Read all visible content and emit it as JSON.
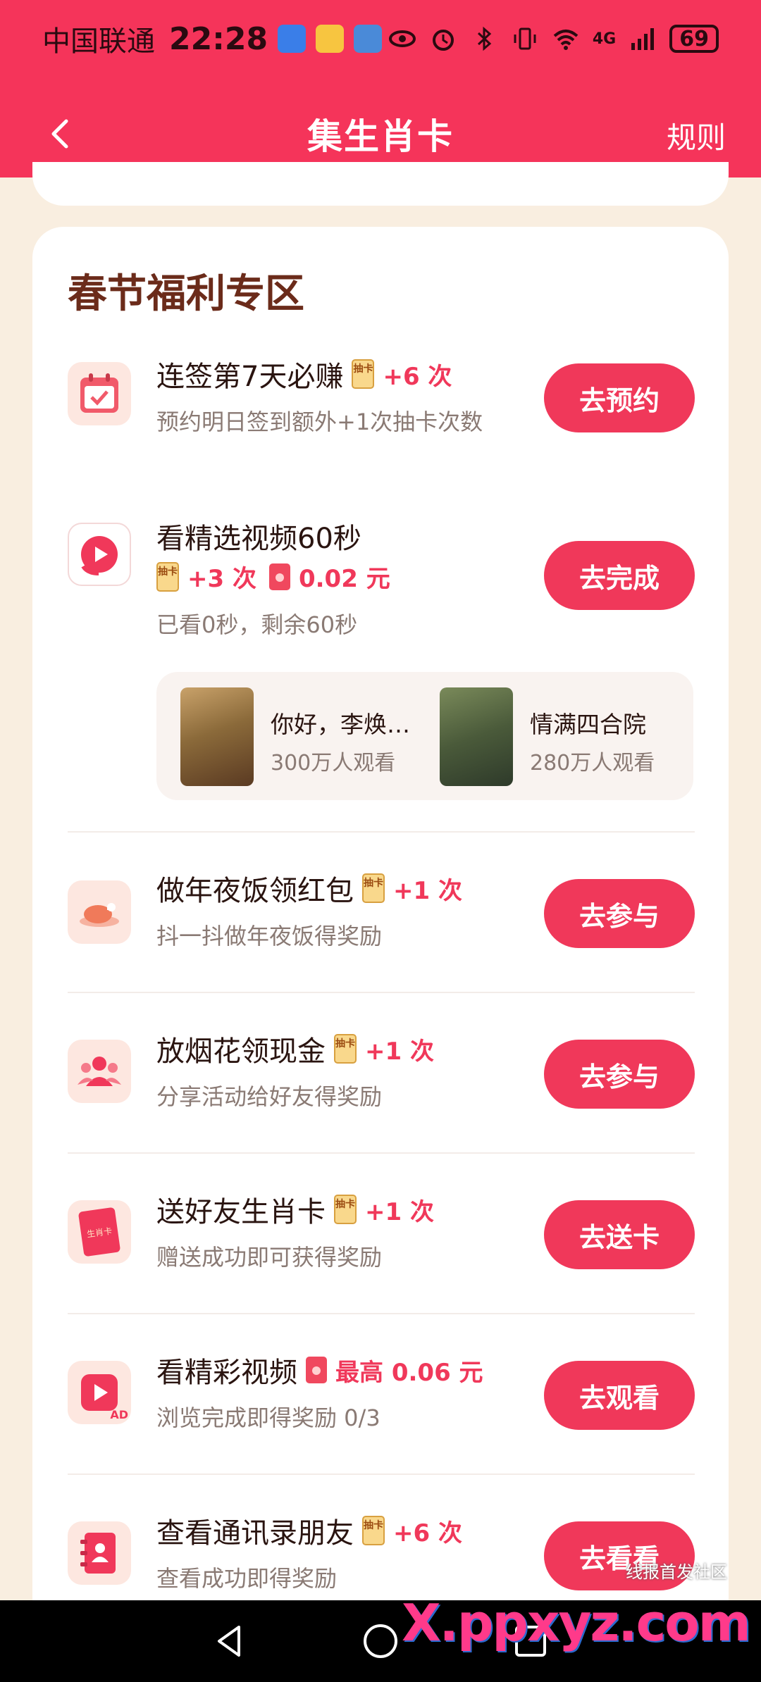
{
  "status_bar": {
    "carrier": "中国联通",
    "time": "22:28",
    "network": "4G",
    "battery": "69"
  },
  "nav": {
    "title": "集生肖卡",
    "rules_label": "规则"
  },
  "section": {
    "title": "春节福利专区"
  },
  "tasks": [
    {
      "title": "连签第7天必赚",
      "chip_label": "抽卡",
      "reward": "+6 次",
      "subtitle": "预约明日签到额外+1次抽卡次数",
      "button": "去预约",
      "icon": "calendar-check-icon"
    },
    {
      "title": "看精选视频60秒",
      "chip_label": "抽卡",
      "reward": "+3 次",
      "cash_reward": "0.02 元",
      "subtitle": "已看0秒，剩余60秒",
      "button": "去完成",
      "icon": "video-play-icon"
    },
    {
      "title": "做年夜饭领红包",
      "chip_label": "抽卡",
      "reward": "+1 次",
      "subtitle": "抖一抖做年夜饭得奖励",
      "button": "去参与",
      "icon": "roast-chicken-icon"
    },
    {
      "title": "放烟花领现金",
      "chip_label": "抽卡",
      "reward": "+1 次",
      "subtitle": "分享活动给好友得奖励",
      "button": "去参与",
      "icon": "friends-icon"
    },
    {
      "title": "送好友生肖卡",
      "chip_label": "抽卡",
      "reward": "+1 次",
      "subtitle": "赠送成功即可获得奖励",
      "button": "去送卡",
      "icon": "zodiac-card-icon",
      "icon_text": "生肖卡"
    },
    {
      "title": "看精彩视频",
      "reward": "最高 0.06 元",
      "subtitle": "浏览完成即得奖励 0/3",
      "button": "去观看",
      "icon": "ad-video-icon",
      "icon_text": "AD"
    },
    {
      "title": "查看通讯录朋友",
      "chip_label": "抽卡",
      "reward": "+6 次",
      "subtitle": "查看成功即得奖励",
      "button": "去看看",
      "icon": "contacts-book-icon"
    }
  ],
  "videos": [
    {
      "name": "你好，李焕…",
      "views": "300万人观看"
    },
    {
      "name": "情满四合院",
      "views": "280万人观看"
    }
  ],
  "watermark": {
    "text": "线报首发社区",
    "logo": "X.ppxyz.com"
  },
  "colors": {
    "header": "#f5345a",
    "accent": "#f0385a",
    "background": "#f9eee0",
    "section_title": "#6b2b1a"
  }
}
